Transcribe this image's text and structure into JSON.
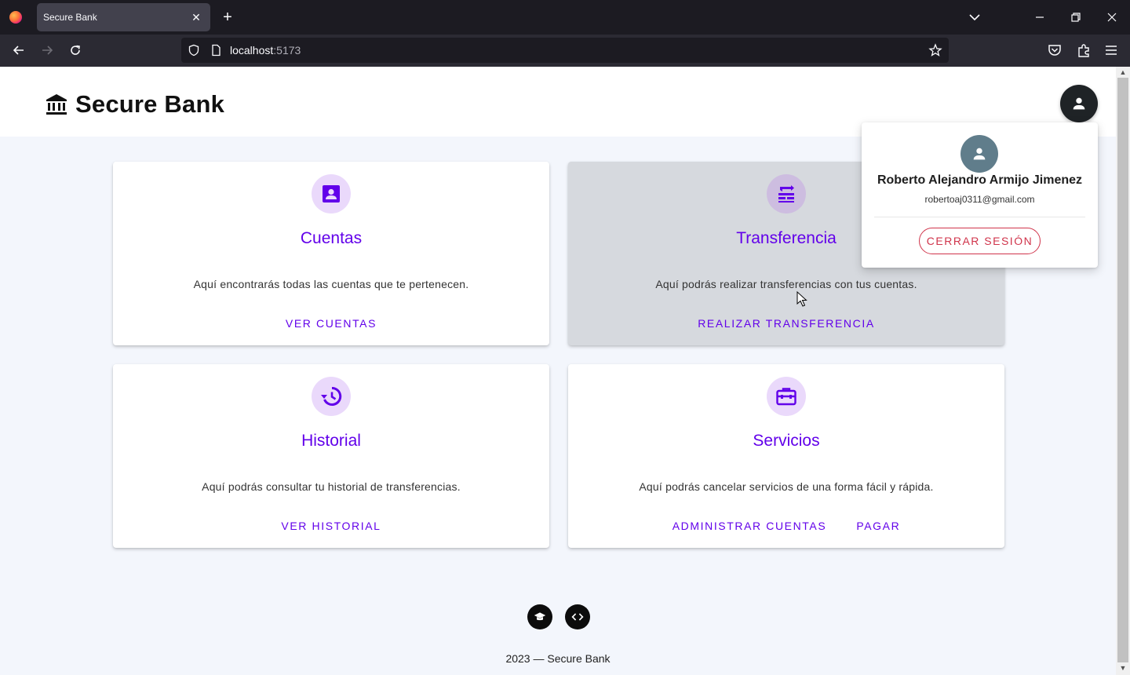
{
  "browser": {
    "tab_title": "Secure Bank",
    "url_host": "localhost",
    "url_port": ":5173"
  },
  "header": {
    "title": "Secure Bank"
  },
  "cards": [
    {
      "title": "Cuentas",
      "description": "Aquí encontrarás todas las cuentas que te pertenecen.",
      "actions": [
        "VER CUENTAS"
      ],
      "icon": "account-box-icon"
    },
    {
      "title": "Transferencia",
      "description": "Aquí podrás realizar transferencias con tus cuentas.",
      "actions": [
        "REALIZAR TRANSFERENCIA"
      ],
      "icon": "transfer-icon"
    },
    {
      "title": "Historial",
      "description": "Aquí podrás consultar tu historial de transferencias.",
      "actions": [
        "VER HISTORIAL"
      ],
      "icon": "history-icon"
    },
    {
      "title": "Servicios",
      "description": "Aquí podrás cancelar servicios de una forma fácil y rápida.",
      "actions": [
        "ADMINISTRAR CUENTAS",
        "PAGAR"
      ],
      "icon": "toolbox-icon"
    }
  ],
  "profile": {
    "name": "Roberto Alejandro Armijo Jimenez",
    "email": "robertoaj0311@gmail.com",
    "logout_label": "CERRAR SESIÓN"
  },
  "footer": {
    "text": "2023 — Secure Bank"
  },
  "colors": {
    "accent": "#6200ea",
    "danger": "#d0344b",
    "icon_bg": "#ead9fb"
  }
}
